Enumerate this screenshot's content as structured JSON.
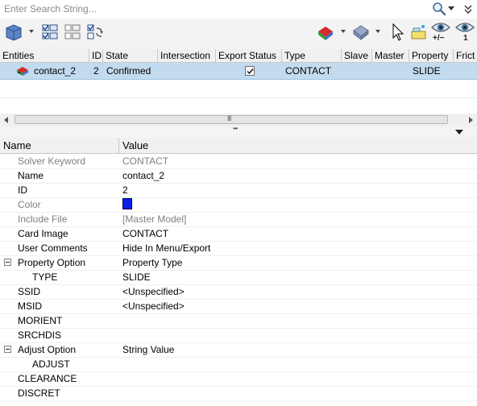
{
  "search": {
    "placeholder": "Enter Search String..."
  },
  "toolbar": {
    "icons": [
      "view-entity-icon",
      "select-all-icon",
      "deselect-icon",
      "swap-selection-icon",
      "entity-color-icon",
      "display-mode-icon",
      "cursor-icon",
      "highlight-icon",
      "show-hide-toggle-icon",
      "show-only-icon"
    ],
    "show_hide_label": "+/−",
    "show_only_label": "1"
  },
  "entity_table": {
    "columns": [
      "Entities",
      "ID",
      "State",
      "Intersection",
      "Export Status",
      "Type",
      "Slave",
      "Master",
      "Property",
      "Frict"
    ],
    "row": {
      "name": "contact_2",
      "id": "2",
      "state": "Confirmed",
      "intersection": "",
      "export_checked": true,
      "type": "CONTACT",
      "slave": "",
      "master": "",
      "property": "SLIDE"
    }
  },
  "scrollbar": {
    "grip": "III"
  },
  "splitter": {
    "grip": "•••"
  },
  "property_grid": {
    "headers": {
      "name": "Name",
      "value": "Value"
    },
    "rows": [
      {
        "name": "Solver Keyword",
        "value": "CONTACT",
        "muted": true
      },
      {
        "name": "Name",
        "value": "contact_2"
      },
      {
        "name": "ID",
        "value": "2"
      },
      {
        "name": "Color",
        "value": "",
        "muted": true,
        "color": "#0a1ee6"
      },
      {
        "name": "Include File",
        "value": "[Master Model]",
        "muted": true
      },
      {
        "name": "Card Image",
        "value": "CONTACT"
      },
      {
        "name": "User Comments",
        "value": "Hide In Menu/Export"
      },
      {
        "name": "Property Option",
        "value": "Property Type",
        "group": true
      },
      {
        "name": "TYPE",
        "value": "SLIDE",
        "indent": true
      },
      {
        "name": "SSID",
        "value": "<Unspecified>"
      },
      {
        "name": "MSID",
        "value": "<Unspecified>"
      },
      {
        "name": "MORIENT",
        "value": ""
      },
      {
        "name": "SRCHDIS",
        "value": ""
      },
      {
        "name": "Adjust Option",
        "value": "String Value",
        "group": true
      },
      {
        "name": "ADJUST",
        "value": "",
        "indent": true
      },
      {
        "name": "CLEARANCE",
        "value": ""
      },
      {
        "name": "DISCRET",
        "value": ""
      }
    ]
  }
}
